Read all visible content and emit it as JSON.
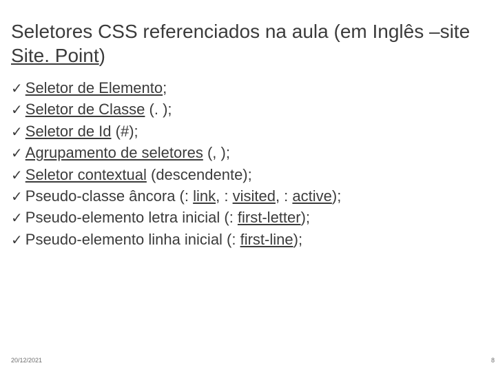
{
  "heading": {
    "pre": "Seletores CSS referenciados na aula (em Inglês –site ",
    "link": "Site. Point",
    "post": ")"
  },
  "items": {
    "i0": {
      "link": "Seletor de Elemento",
      "tail": ";"
    },
    "i1": {
      "link": "Seletor de Classe",
      "tail": " (. );"
    },
    "i2": {
      "link": "Seletor de Id",
      "tail": " (#);"
    },
    "i3": {
      "link": "Agrupamento de seletores",
      "tail": " (, );"
    },
    "i4": {
      "link": "Seletor contextual",
      "tail": " (descendente);"
    },
    "i5": {
      "pre": "Pseudo-classe âncora (: ",
      "l1": "link",
      "m1": ", : ",
      "l2": "visited",
      "m2": ", : ",
      "l3": "active",
      "post": ");"
    },
    "i6": {
      "pre": "Pseudo-elemento letra inicial (: ",
      "l1": "first-letter",
      "post": ");"
    },
    "i7": {
      "pre": "Pseudo-elemento linha inicial (: ",
      "l1": "first-line",
      "post": ");"
    }
  },
  "footer": {
    "date": "20/12/2021",
    "num": "8"
  }
}
